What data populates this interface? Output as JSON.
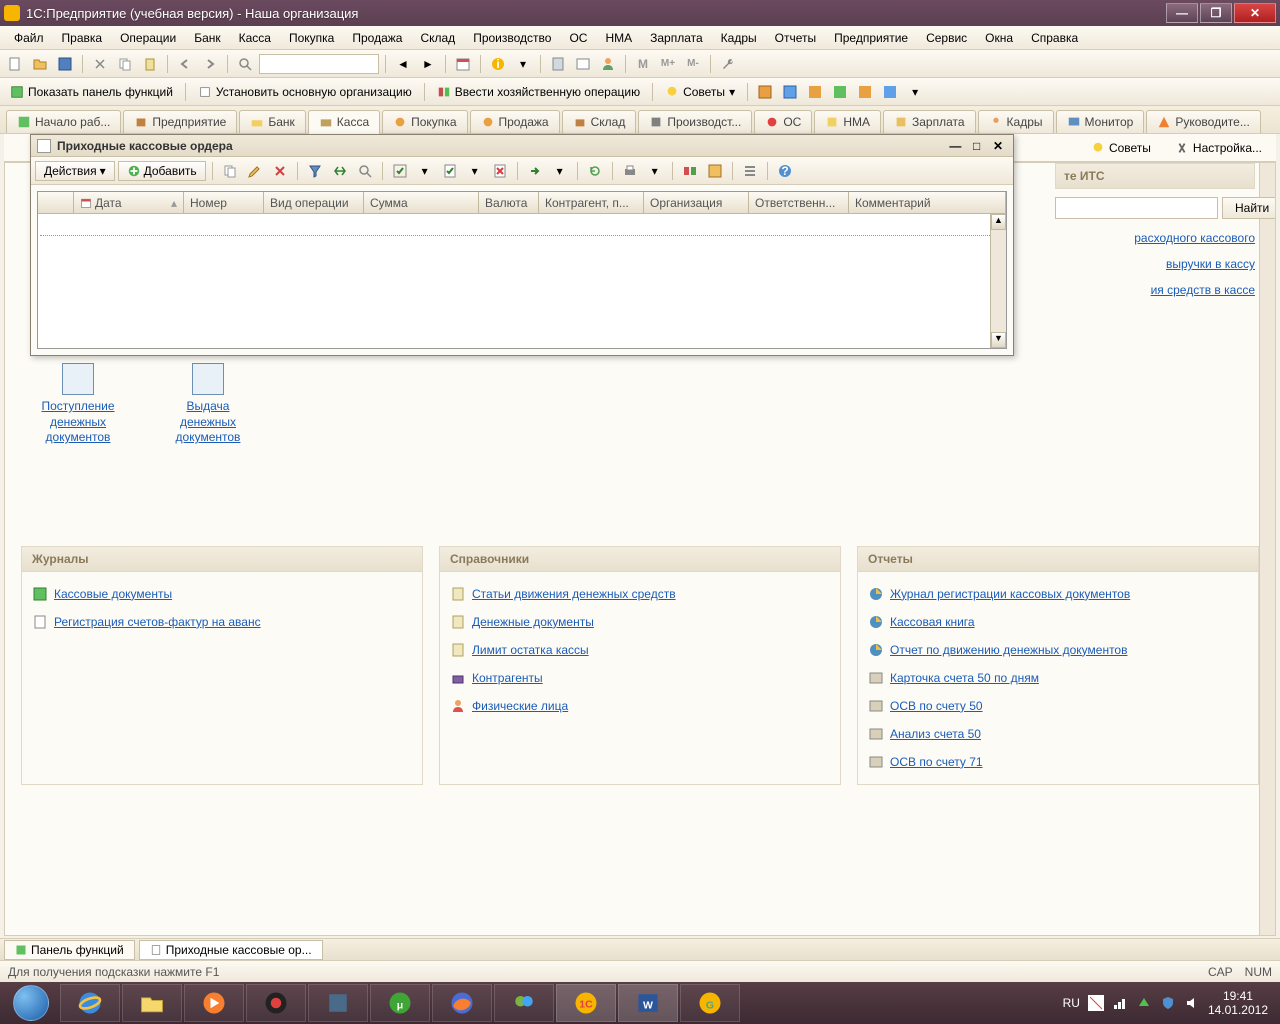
{
  "titlebar": {
    "title": "1С:Предприятие (учебная версия) - Наша организация"
  },
  "menu": [
    "Файл",
    "Правка",
    "Операции",
    "Банк",
    "Касса",
    "Покупка",
    "Продажа",
    "Склад",
    "Производство",
    "ОС",
    "НМА",
    "Зарплата",
    "Кадры",
    "Отчеты",
    "Предприятие",
    "Сервис",
    "Окна",
    "Справка"
  ],
  "toolbar3": {
    "show_panel": "Показать панель функций",
    "set_org": "Установить основную организацию",
    "enter_op": "Ввести хозяйственную операцию",
    "advice": "Советы"
  },
  "tabs": [
    "Начало раб...",
    "Предприятие",
    "Банк",
    "Касса",
    "Покупка",
    "Продажа",
    "Склад",
    "Производст...",
    "ОС",
    "НМА",
    "Зарплата",
    "Кадры",
    "Монитор",
    "Руководите..."
  ],
  "toolbar2": {
    "advice": "Советы",
    "settings": "Настройка..."
  },
  "dialog": {
    "title": "Приходные кассовые ордера",
    "actions": "Действия",
    "add": "Добавить",
    "columns": [
      "",
      "Дата",
      "Номер",
      "Вид операции",
      "Сумма",
      "Валюта",
      "Контрагент, п...",
      "Организация",
      "Ответственн...",
      "Комментарий"
    ]
  },
  "docs": {
    "incoming": "Поступление денежных документов",
    "outgoing": "Выдача денежных документов"
  },
  "rightpanel": {
    "head": "те ИТС",
    "find": "Найти",
    "l1": "расходного кассового",
    "l2": "выручки в кассу",
    "l3": "ия средств в кассе"
  },
  "panels": {
    "journals": {
      "title": "Журналы",
      "items": [
        "Кассовые документы",
        "Регистрация счетов-фактур на аванс"
      ]
    },
    "refs": {
      "title": "Справочники",
      "items": [
        "Статьи движения денежных средств",
        "Денежные документы",
        "Лимит остатка кассы",
        "Контрагенты",
        "Физические лица"
      ]
    },
    "reports": {
      "title": "Отчеты",
      "items": [
        "Журнал регистрации кассовых документов",
        "Кассовая книга",
        "Отчет по движению денежных документов",
        "Карточка счета 50 по дням",
        "ОСВ по счету 50",
        "Анализ счета 50",
        "ОСВ по счету 71"
      ]
    }
  },
  "apptabs": {
    "panel": "Панель функций",
    "dialog": "Приходные кассовые ор..."
  },
  "status": {
    "hint": "Для получения подсказки нажмите F1",
    "cap": "CAP",
    "num": "NUM"
  },
  "tray": {
    "lang": "RU",
    "time": "19:41",
    "date": "14.01.2012"
  }
}
